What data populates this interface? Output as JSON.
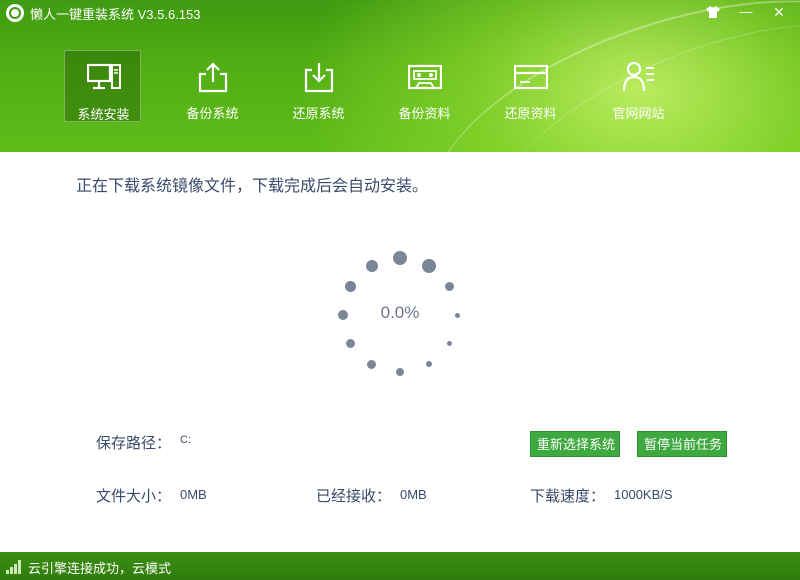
{
  "window": {
    "title": "懒人一键重装系统 V3.5.6.153",
    "controls": {
      "skin_icon": "shirt-icon",
      "minimize": "—",
      "close": "✕"
    }
  },
  "toolbar": {
    "items": [
      {
        "label": "系统安装",
        "icon": "computer-icon",
        "active": true
      },
      {
        "label": "备份系统",
        "icon": "upload-icon",
        "active": false
      },
      {
        "label": "还原系统",
        "icon": "download-icon",
        "active": false
      },
      {
        "label": "备份资料",
        "icon": "cassette-icon",
        "active": false
      },
      {
        "label": "还原资料",
        "icon": "card-icon",
        "active": false
      },
      {
        "label": "官网网站",
        "icon": "person-icon",
        "active": false
      }
    ]
  },
  "main": {
    "message": "正在下载系统镜像文件，下载完成后会自动安装。",
    "progress_text": "0.0%",
    "progress": 0.0,
    "save_path": {
      "label": "保存路径：",
      "value": "C:"
    },
    "file_size": {
      "label": "文件大小：",
      "value": "0MB"
    },
    "received": {
      "label": "已经接收：",
      "value": "0MB"
    },
    "speed": {
      "label": "下载速度：",
      "value": "1000KB/S"
    },
    "buttons": {
      "reselect": "重新选择系统",
      "pause": "暂停当前任务"
    }
  },
  "status": {
    "text": "云引擎连接成功，云模式"
  },
  "colors": {
    "header": "#51ad14",
    "button": "#3da93f",
    "text": "#3a4a6a",
    "status": "#2f7c0c"
  }
}
